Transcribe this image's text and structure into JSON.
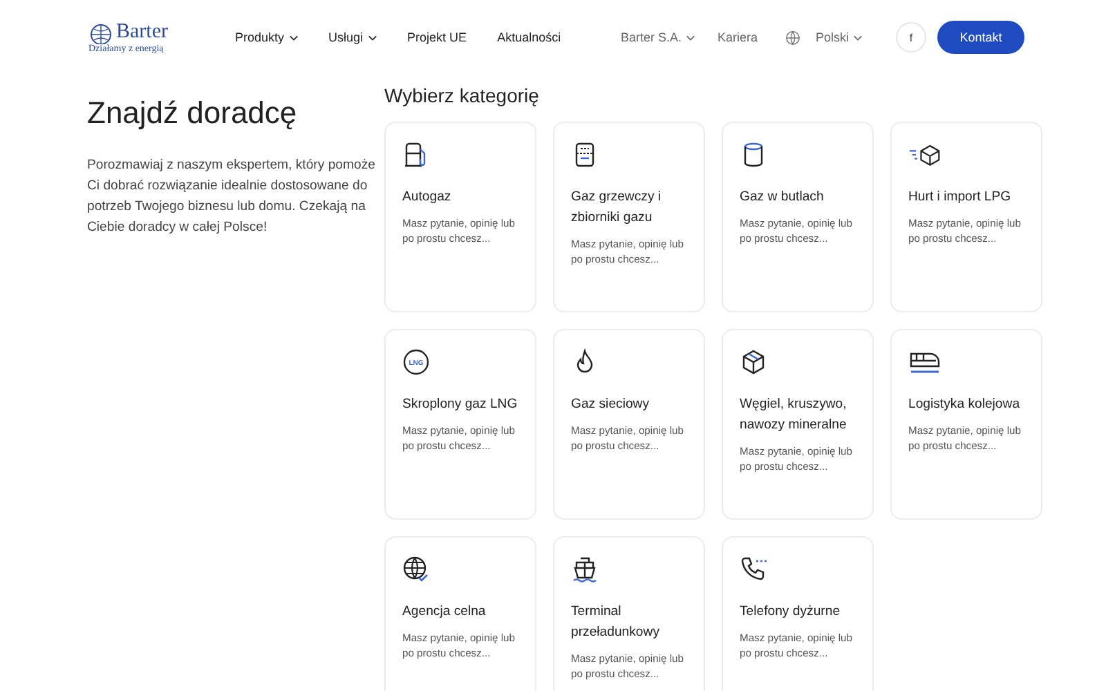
{
  "header": {
    "logo": {
      "name": "Barter",
      "tagline": "Działamy z energią"
    },
    "nav": [
      {
        "label": "Produkty",
        "dropdown": true
      },
      {
        "label": "Usługi",
        "dropdown": true
      },
      {
        "label": "Projekt UE",
        "dropdown": false
      },
      {
        "label": "Aktualności",
        "dropdown": false
      }
    ],
    "company": {
      "label": "Barter S.A.",
      "dropdown": true
    },
    "career": "Kariera",
    "language": {
      "label": "Polski",
      "dropdown": true
    },
    "facebook": "f",
    "cta": "Kontakt"
  },
  "intro": {
    "title": "Znajdź doradcę",
    "text": "Porozmawiaj z naszym ekspertem, który pomoże Ci dobrać rozwiązanie idealnie dostosowane do potrzeb Twojego biznesu lub domu. Czekają na Ciebie doradcy w całej Polsce!"
  },
  "categories": {
    "title": "Wybierz kategorię",
    "items": [
      {
        "kind": "pump",
        "title": "Autogaz",
        "text": "Masz pytanie, opinię lub po prostu chcesz..."
      },
      {
        "kind": "tank",
        "title": "Gaz grzewczy i zbiorniki gazu",
        "text": "Masz pytanie, opinię lub po prostu chcesz..."
      },
      {
        "kind": "cylinder",
        "title": "Gaz w butlach",
        "text": "Masz pytanie, opinię lub po prostu chcesz..."
      },
      {
        "kind": "fastbox",
        "title": "Hurt i import LPG",
        "text": "Masz pytanie, opinię lub po prostu chcesz..."
      },
      {
        "kind": "lng",
        "title": "Skroplony gaz LNG",
        "text": "Masz pytanie, opinię lub po prostu chcesz...",
        "icon_text": "LNG"
      },
      {
        "kind": "flame",
        "title": "Gaz sieciowy",
        "text": "Masz pytanie, opinię lub po prostu chcesz..."
      },
      {
        "kind": "box",
        "title": "Węgiel, kruszywo, nawozy mineralne",
        "text": "Masz pytanie, opinię lub po prostu chcesz..."
      },
      {
        "kind": "train",
        "title": "Logistyka kolejowa",
        "text": "Masz pytanie, opinię lub po prostu chcesz..."
      },
      {
        "kind": "globe",
        "title": "Agencja celna",
        "text": "Masz pytanie, opinię lub po prostu chcesz..."
      },
      {
        "kind": "ship",
        "title": "Terminal przeładunkowy",
        "text": "Masz pytanie, opinię lub po prostu chcesz..."
      },
      {
        "kind": "phone",
        "title": "Telefony dyżurne",
        "text": "Masz pytanie, opinię lub po prostu chcesz..."
      }
    ]
  }
}
